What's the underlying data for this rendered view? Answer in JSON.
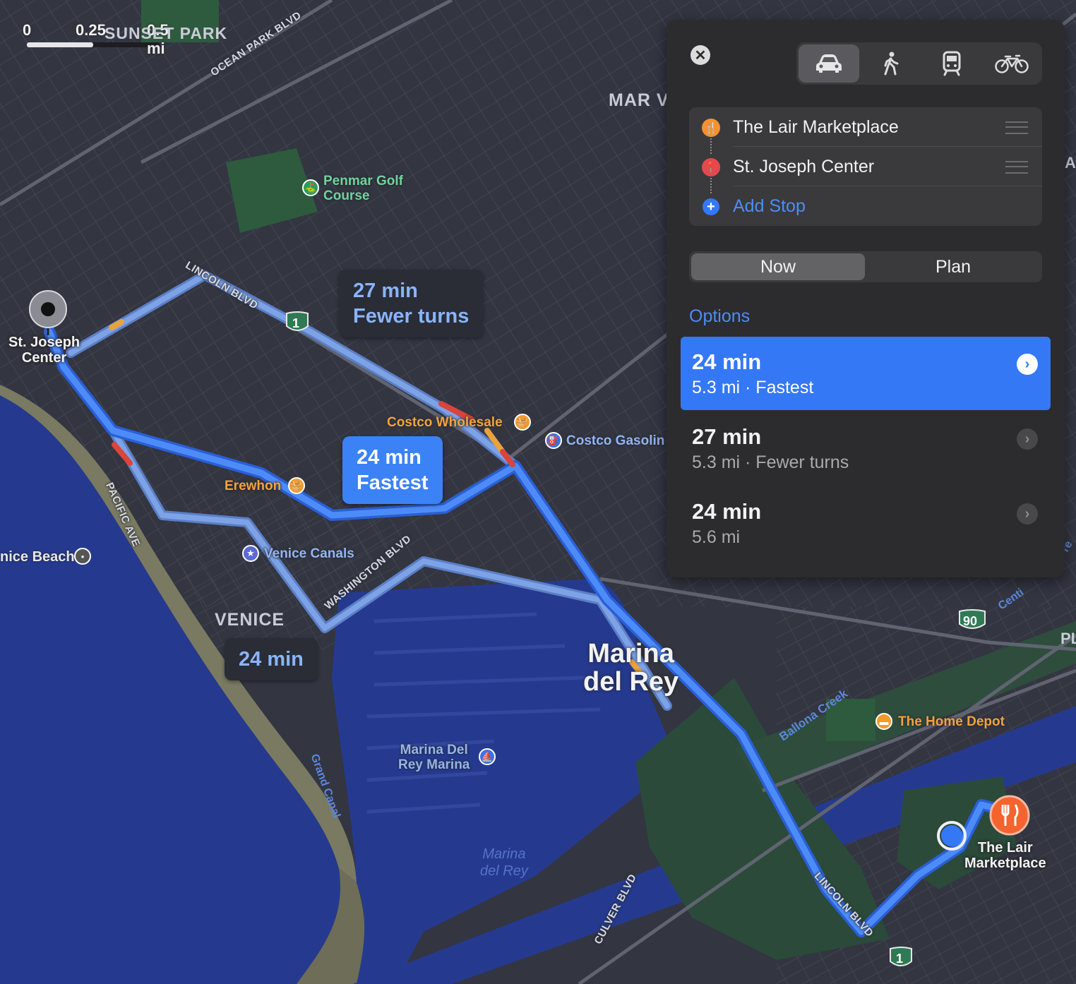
{
  "scale": {
    "labels": [
      "0",
      "0.25",
      "0.5 mi"
    ]
  },
  "map": {
    "areas": [
      "SUNSET PARK",
      "MAR VI",
      "VENICE",
      "Marina\ndel Rey",
      "Marina\ndel Rey",
      "PL",
      "Al"
    ],
    "roads": [
      "OCEAN PARK BLVD",
      "LINCOLN BLVD",
      "PACIFIC AVE",
      "WASHINGTON BLVD",
      "CULVER BLVD",
      "LINCOLN BLVD",
      "Ballona Creek",
      "Grand Canal",
      "Centi",
      "re"
    ],
    "pois": {
      "penmar": "Penmar Golf\nCourse",
      "costco_wholesale": "Costco Wholesale",
      "costco_gas": "Costco Gasolin",
      "erewhon": "Erewhon",
      "venice_canals": "Venice Canals",
      "venice_beach": "nice Beach",
      "marina_del_rey_marina": "Marina Del\nRey Marina",
      "home_depot": "The Home Depot"
    },
    "start_label": "St. Joseph\nCenter",
    "end_label": "The Lair\nMarketplace",
    "shields": [
      "1",
      "1",
      "90"
    ],
    "route_bubbles": [
      {
        "line1": "27 min",
        "line2": "Fewer turns"
      },
      {
        "line1": "24 min",
        "line2": "Fastest"
      },
      {
        "line1": "24 min",
        "line2": ""
      }
    ]
  },
  "panel": {
    "close_icon": "close-icon",
    "modes": [
      {
        "name": "car-icon",
        "active": true
      },
      {
        "name": "walk-icon",
        "active": false
      },
      {
        "name": "transit-icon",
        "active": false
      },
      {
        "name": "bike-icon",
        "active": false
      }
    ],
    "stops": [
      {
        "label": "The Lair Marketplace",
        "icon": "fork-knife-icon",
        "color": "#f5922f"
      },
      {
        "label": "St. Joseph Center",
        "icon": "pin-icon",
        "color": "#e5484d"
      }
    ],
    "add_stop": "Add Stop",
    "segment": {
      "now": "Now",
      "plan": "Plan"
    },
    "options_header": "Options",
    "options": [
      {
        "time": "24 min",
        "detail": "5.3 mi · Fastest",
        "selected": true
      },
      {
        "time": "27 min",
        "detail": "5.3 mi · Fewer turns",
        "selected": false
      },
      {
        "time": "24 min",
        "detail": "5.6 mi",
        "selected": false
      }
    ]
  },
  "colors": {
    "accent": "#3478f6",
    "route_primary": "#3d82f7",
    "route_alt": "#6e94d8",
    "water": "#253a8f",
    "land": "#333541",
    "traffic_heavy": "#d9453a",
    "traffic_moderate": "#e8a33d"
  }
}
